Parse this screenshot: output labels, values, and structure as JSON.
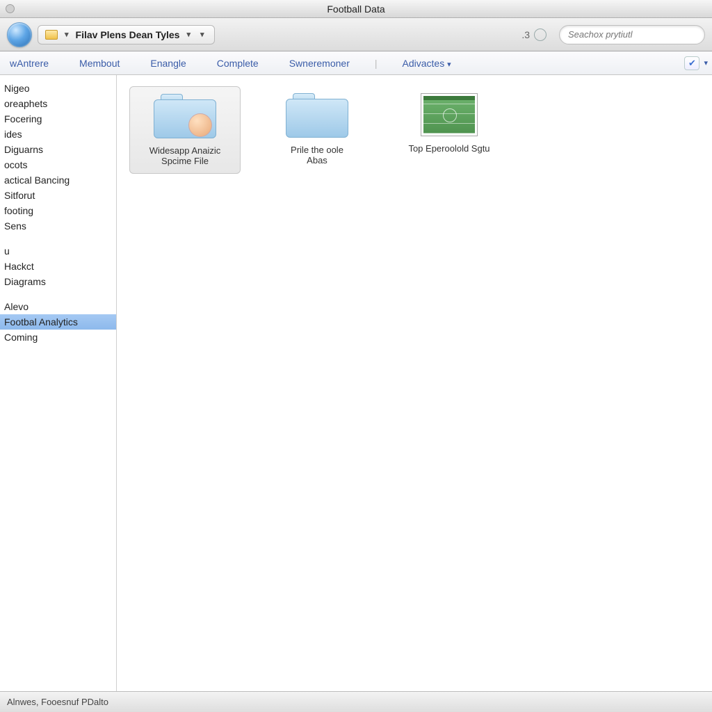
{
  "window": {
    "title": "Football Data"
  },
  "toolbar": {
    "path_label": "Filav Plens  Dean Tyles",
    "count": ".3",
    "search_placeholder": "Seachox prytiutl"
  },
  "tabs": {
    "items": [
      "wAntrere",
      "Membout",
      "Enangle",
      "Complete",
      "Swneremoner"
    ],
    "advanced": "Adivactes"
  },
  "sidebar": {
    "group1": [
      "Nigeo",
      "oreaphets",
      "Focering",
      "ides",
      "Diguarns",
      "ocots",
      "actical Bancing",
      "Sitforut",
      "footing",
      "Sens"
    ],
    "group2": [
      "u",
      "Hackct",
      "Diagrams"
    ],
    "group3": [
      "Alevo",
      "Footbal Analytics",
      "Coming"
    ],
    "selected": "Footbal Analytics"
  },
  "files": [
    {
      "label_line1": "Widesapp Anaizic",
      "label_line2": "Spcime File",
      "kind": "folder-doll",
      "selected": true
    },
    {
      "label_line1": "Prile the oole",
      "label_line2": "Abas",
      "kind": "folder",
      "selected": false
    },
    {
      "label_line1": "Top Eperoolold Sgtu",
      "label_line2": "",
      "kind": "pitch",
      "selected": false
    }
  ],
  "statusbar": {
    "text": "Alnwes,  Fooesnuf PDalto"
  }
}
